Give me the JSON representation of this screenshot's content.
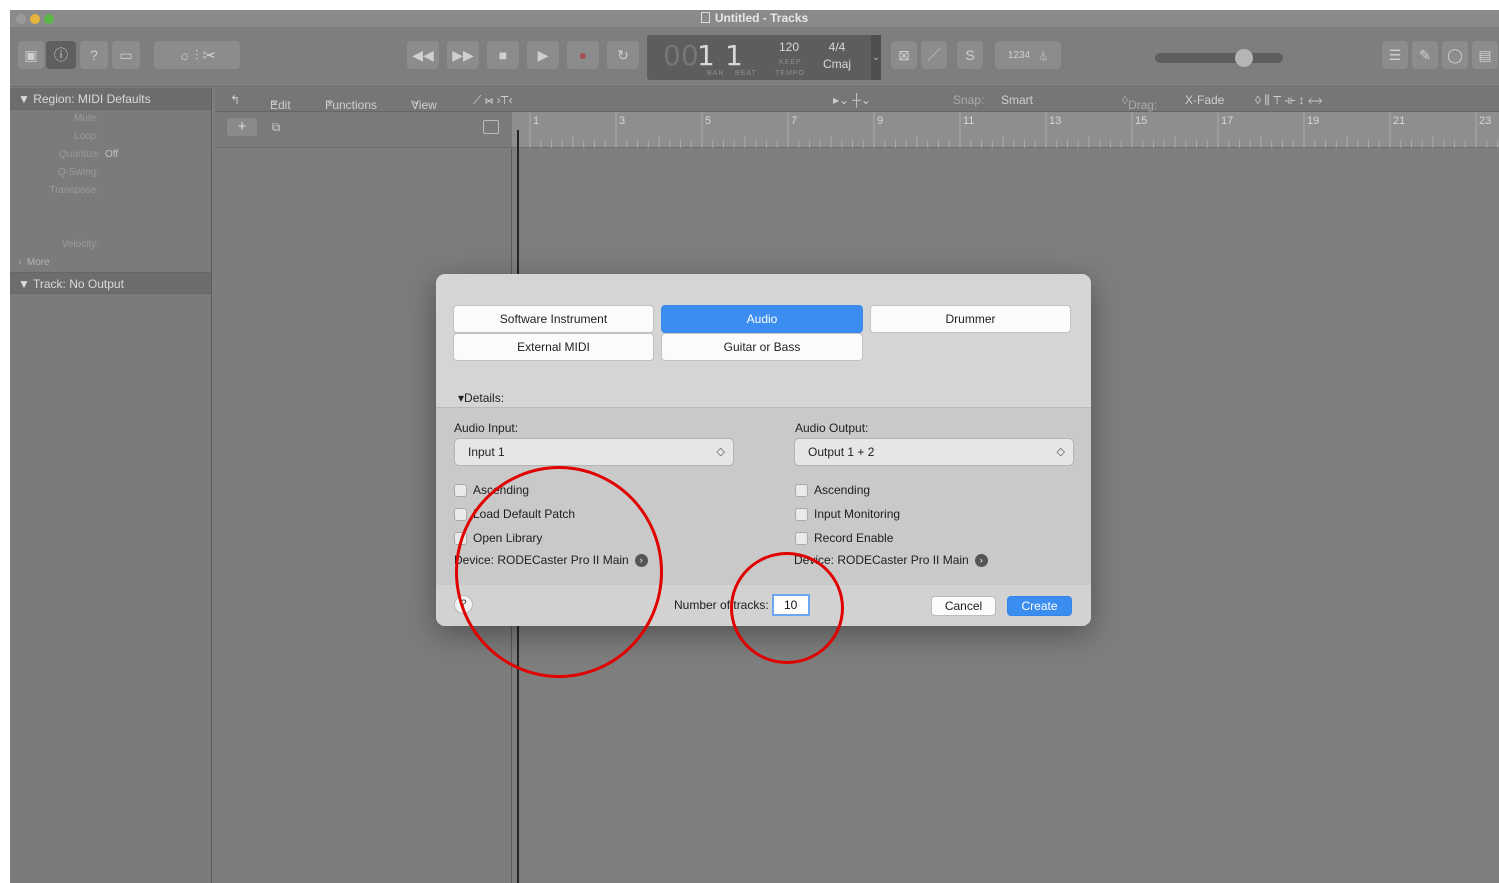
{
  "window": {
    "title": "Untitled - Tracks"
  },
  "lcd": {
    "bar": "1",
    "beat": "1",
    "bar_label": "BAR",
    "beat_label": "BEAT",
    "tempo": "120",
    "tempo_mode": "KEEP",
    "tempo_label": "TEMPO",
    "signature": "4/4",
    "key": "Cmaj"
  },
  "control_bar": {
    "count_in": "1234"
  },
  "inspector": {
    "region_header": "Region: MIDI Defaults",
    "rows": [
      {
        "label": "Mute:",
        "value": ""
      },
      {
        "label": "Loop:",
        "value": ""
      },
      {
        "label": "Quantize",
        "value": "Off"
      },
      {
        "label": "Q-Swing:",
        "value": ""
      },
      {
        "label": "Transpose:",
        "value": ""
      },
      {
        "label": "",
        "value": ""
      },
      {
        "label": "",
        "value": ""
      },
      {
        "label": "Velocity:",
        "value": ""
      }
    ],
    "more": "More",
    "track_header": "Track: No Output"
  },
  "tracks_toolbar": {
    "edit": "Edit",
    "functions": "Functions",
    "view": "View",
    "snap_label": "Snap:",
    "snap_value": "Smart",
    "drag_label": "Drag:",
    "drag_value": "X-Fade"
  },
  "ruler": {
    "bars": [
      "1",
      "3",
      "5",
      "7",
      "9",
      "11",
      "13",
      "15",
      "17",
      "19",
      "21",
      "23"
    ]
  },
  "dialog": {
    "track_types": [
      {
        "label": "Software Instrument",
        "selected": false
      },
      {
        "label": "Audio",
        "selected": true
      },
      {
        "label": "Drummer",
        "selected": false
      },
      {
        "label": "External MIDI",
        "selected": false
      },
      {
        "label": "Guitar or Bass",
        "selected": false
      }
    ],
    "details_label": "Details:",
    "audio_input": {
      "label": "Audio Input:",
      "value": "Input 1",
      "options": [
        {
          "label": "Ascending",
          "checked": false
        },
        {
          "label": "Load Default Patch",
          "checked": false
        },
        {
          "label": "Open Library",
          "checked": false
        }
      ],
      "device": "Device: RODECaster Pro II Main"
    },
    "audio_output": {
      "label": "Audio Output:",
      "value": "Output 1 + 2",
      "options": [
        {
          "label": "Ascending",
          "checked": false
        },
        {
          "label": "Input Monitoring",
          "checked": false
        },
        {
          "label": "Record Enable",
          "checked": false
        }
      ],
      "device": "Device: RODECaster Pro II Main"
    },
    "number_of_tracks_label": "Number of tracks:",
    "number_of_tracks_value": "10",
    "cancel": "Cancel",
    "create": "Create"
  },
  "colors": {
    "accent": "#3b8df0",
    "annotation": "#e00000"
  }
}
